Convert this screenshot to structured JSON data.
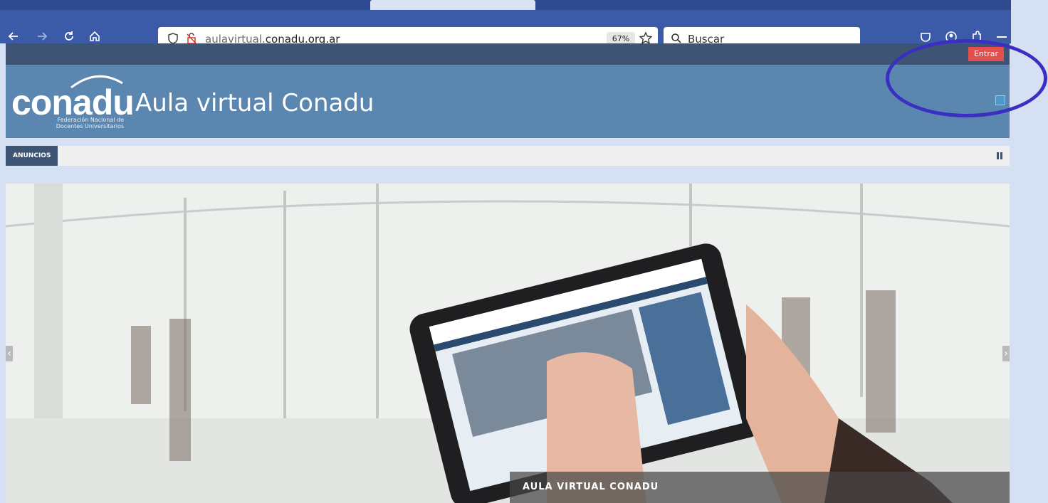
{
  "browser": {
    "url_prefix": "aulavirtual.",
    "url_domain": "conadu.org.ar",
    "zoom": "67%",
    "search_placeholder": "Buscar"
  },
  "page": {
    "login_button": "Entrar",
    "logo_word": "conadu",
    "logo_sub_line1": "Federación Nacional de",
    "logo_sub_line2": "Docentes Universitarios",
    "site_name": "Aula virtual Conadu",
    "news_tab": "ANUNCIOS",
    "slide_caption": "AULA VIRTUAL CONADU"
  },
  "annotation": {
    "circle_color": "#3a2fc1"
  }
}
